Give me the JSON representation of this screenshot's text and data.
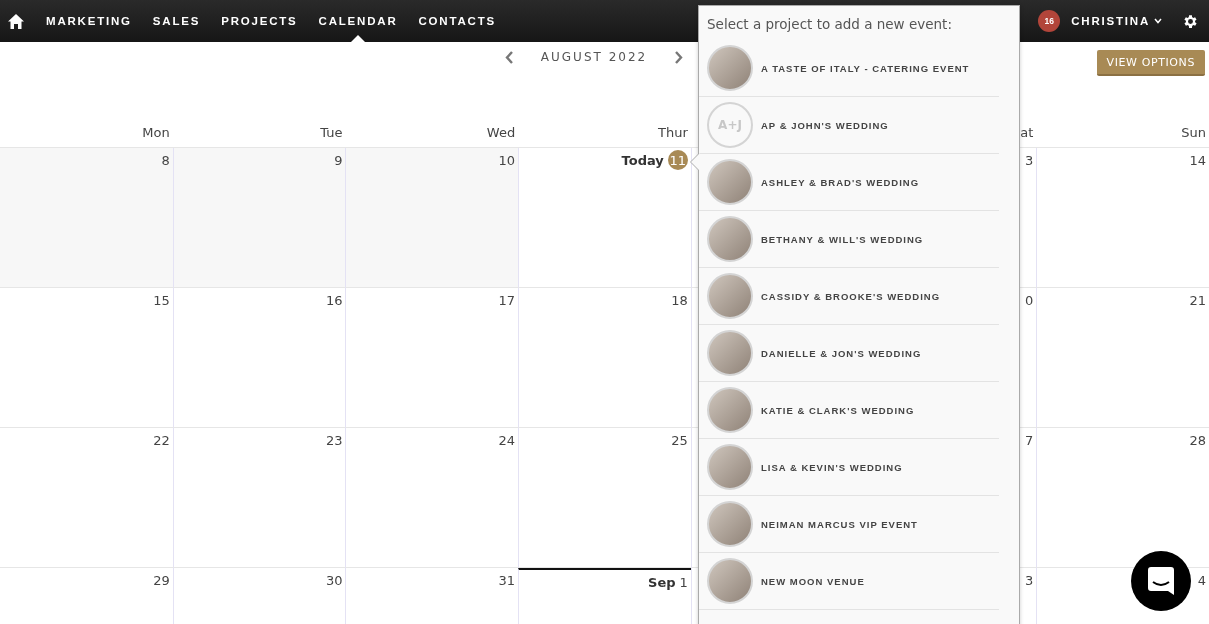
{
  "nav": {
    "items": [
      {
        "label": "MARKETING",
        "selected": false
      },
      {
        "label": "SALES",
        "selected": false
      },
      {
        "label": "PROJECTS",
        "selected": false
      },
      {
        "label": "CALENDAR",
        "selected": true
      },
      {
        "label": "CONTACTS",
        "selected": false
      }
    ],
    "notifications": "16",
    "user": "CHRISTINA"
  },
  "toolbar": {
    "month": "AUGUST 2022",
    "view_button": "VIEW OPTIONS"
  },
  "calendar": {
    "columns": [
      "Mon",
      "Tue",
      "Wed",
      "Thur",
      "at",
      "Sun"
    ],
    "weeks": [
      {
        "days": [
          {
            "kind": "past",
            "number": "8"
          },
          {
            "kind": "past",
            "number": "9"
          },
          {
            "kind": "past",
            "number": "10"
          },
          {
            "kind": "today",
            "prefix": "Today",
            "number": "11"
          },
          {
            "kind": "normal",
            "number": "3"
          },
          {
            "kind": "normal",
            "number": "14"
          }
        ]
      },
      {
        "days": [
          {
            "kind": "normal",
            "number": "15"
          },
          {
            "kind": "normal",
            "number": "16"
          },
          {
            "kind": "normal",
            "number": "17"
          },
          {
            "kind": "normal",
            "number": "18"
          },
          {
            "kind": "normal",
            "number": "0"
          },
          {
            "kind": "normal",
            "number": "21"
          }
        ]
      },
      {
        "days": [
          {
            "kind": "normal",
            "number": "22"
          },
          {
            "kind": "normal",
            "number": "23"
          },
          {
            "kind": "normal",
            "number": "24"
          },
          {
            "kind": "normal",
            "number": "25"
          },
          {
            "kind": "normal",
            "number": "7"
          },
          {
            "kind": "normal",
            "number": "28"
          }
        ]
      },
      {
        "days": [
          {
            "kind": "normal",
            "number": "29"
          },
          {
            "kind": "normal",
            "number": "30"
          },
          {
            "kind": "normal",
            "number": "31"
          },
          {
            "kind": "month_start",
            "prefix": "Sep",
            "number": "1"
          },
          {
            "kind": "normal",
            "number": "3"
          },
          {
            "kind": "normal",
            "number": "4"
          }
        ]
      }
    ]
  },
  "project_picker": {
    "title": "Select a project to add a new event:",
    "projects": [
      {
        "name": "A TASTE OF ITALY - CATERING EVENT",
        "kind": "photo"
      },
      {
        "name": "AP & JOHN'S WEDDING",
        "kind": "initials",
        "initials": "A+J"
      },
      {
        "name": "ASHLEY & BRAD'S WEDDING",
        "kind": "photo"
      },
      {
        "name": "BETHANY & WILL'S WEDDING",
        "kind": "photo"
      },
      {
        "name": "CASSIDY & BROOKE'S WEDDING",
        "kind": "photo"
      },
      {
        "name": "DANIELLE & JON'S WEDDING",
        "kind": "photo"
      },
      {
        "name": "KATIE & CLARK'S WEDDING",
        "kind": "photo"
      },
      {
        "name": "LISA & KEVIN'S WEDDING",
        "kind": "photo"
      },
      {
        "name": "NEIMAN MARCUS VIP EVENT",
        "kind": "photo"
      },
      {
        "name": "NEW MOON VENUE",
        "kind": "photo"
      }
    ]
  }
}
